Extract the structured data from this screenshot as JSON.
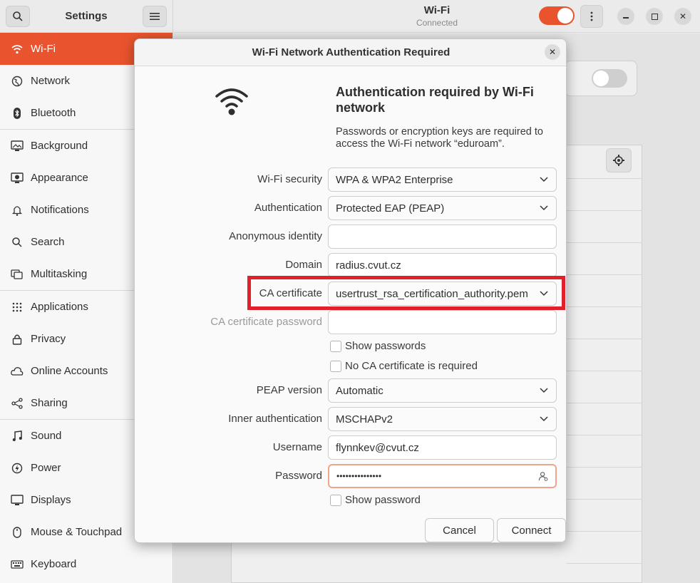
{
  "sidebar": {
    "title": "Settings",
    "items": [
      {
        "label": "Wi-Fi",
        "icon": "wifi-icon",
        "active": true
      },
      {
        "label": "Network",
        "icon": "network-icon"
      },
      {
        "label": "Bluetooth",
        "icon": "bluetooth-icon"
      },
      {
        "label": "Background",
        "icon": "background-icon"
      },
      {
        "label": "Appearance",
        "icon": "appearance-icon"
      },
      {
        "label": "Notifications",
        "icon": "bell-icon"
      },
      {
        "label": "Search",
        "icon": "search-icon"
      },
      {
        "label": "Multitasking",
        "icon": "multitasking-icon"
      },
      {
        "label": "Applications",
        "icon": "apps-grid-icon"
      },
      {
        "label": "Privacy",
        "icon": "lock-icon"
      },
      {
        "label": "Online Accounts",
        "icon": "cloud-icon"
      },
      {
        "label": "Sharing",
        "icon": "share-icon"
      },
      {
        "label": "Sound",
        "icon": "music-note-icon"
      },
      {
        "label": "Power",
        "icon": "power-icon"
      },
      {
        "label": "Displays",
        "icon": "display-icon"
      },
      {
        "label": "Mouse & Touchpad",
        "icon": "mouse-icon"
      },
      {
        "label": "Keyboard",
        "icon": "keyboard-icon"
      }
    ]
  },
  "header": {
    "title": "Wi-Fi",
    "subtitle": "Connected"
  },
  "dialog": {
    "title": "Wi-Fi Network Authentication Required",
    "heading": "Authentication required by Wi-Fi network",
    "description": "Passwords or encryption keys are required to access the Wi-Fi network “eduroam”.",
    "fields": {
      "wifi_security": {
        "label": "Wi-Fi security",
        "value": "WPA & WPA2 Enterprise"
      },
      "authentication": {
        "label": "Authentication",
        "value": "Protected EAP (PEAP)"
      },
      "anonymous_identity": {
        "label": "Anonymous identity",
        "value": ""
      },
      "domain": {
        "label": "Domain",
        "value": "radius.cvut.cz"
      },
      "ca_certificate": {
        "label": "CA certificate",
        "value": "usertrust_rsa_certification_authority.pem"
      },
      "ca_certificate_password": {
        "label": "CA certificate password",
        "value": ""
      },
      "peap_version": {
        "label": "PEAP version",
        "value": "Automatic"
      },
      "inner_authentication": {
        "label": "Inner authentication",
        "value": "MSCHAPv2"
      },
      "username": {
        "label": "Username",
        "value": "flynnkev@cvut.cz"
      },
      "password": {
        "label": "Password",
        "value": "•••••••••••••••"
      }
    },
    "checkboxes": {
      "show_passwords": "Show passwords",
      "no_ca_required": "No CA certificate is required",
      "show_password": "Show password"
    },
    "buttons": {
      "cancel": "Cancel",
      "connect": "Connect"
    }
  },
  "colors": {
    "accent": "#e9542e",
    "highlight": "#e0202a"
  }
}
